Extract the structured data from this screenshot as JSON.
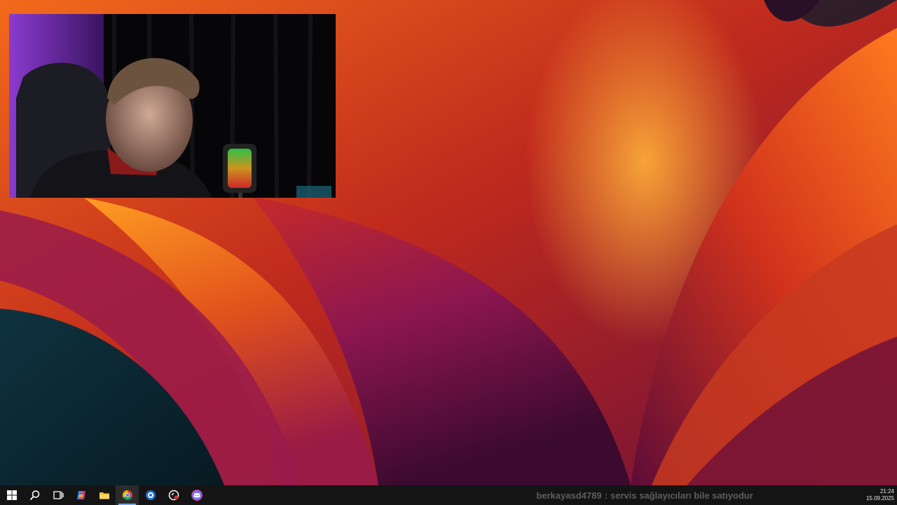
{
  "taskbar": {
    "icons": [
      {
        "name": "windows-start-icon",
        "active": false
      },
      {
        "name": "search-icon",
        "active": false
      },
      {
        "name": "task-view-icon",
        "active": false
      },
      {
        "name": "copilot-icon",
        "active": false
      },
      {
        "name": "file-explorer-icon",
        "active": false
      },
      {
        "name": "chrome-icon",
        "active": true
      },
      {
        "name": "app-blue-circle-icon",
        "active": false
      },
      {
        "name": "app-red-circle-icon",
        "active": false
      },
      {
        "name": "discord-icon",
        "active": false
      }
    ],
    "chat_message": {
      "user": "berkayasd4789",
      "separator": ":",
      "text": "servis sağlayıcıları bile satıyodur"
    },
    "clock": {
      "time": "21:24",
      "date": "15.09.2025"
    }
  },
  "colors": {
    "taskbar_bg": "#141414",
    "chrome_active_underline": "#7aa7e6",
    "ticker_text": "#5e5e5e",
    "wallpaper_dark": "#0b2731",
    "wallpaper_orange": "#f08a1a",
    "wallpaper_magenta": "#8a1a5a"
  }
}
